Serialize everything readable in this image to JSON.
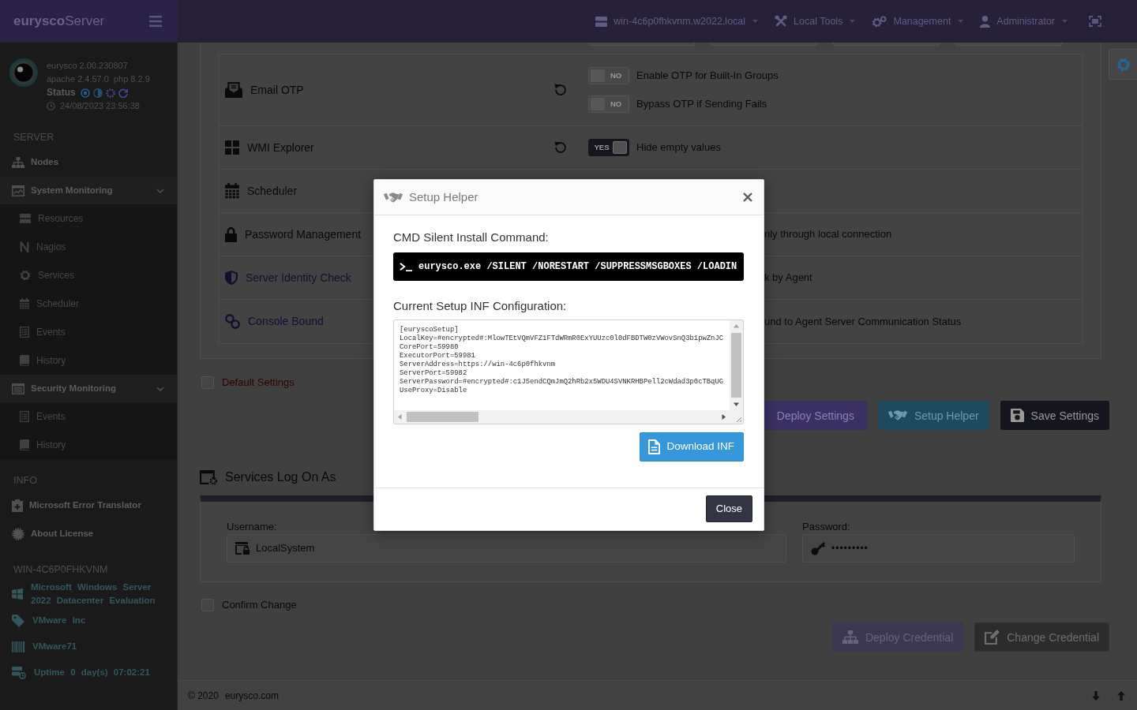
{
  "navbar": {
    "brand": "**eurysco**Server",
    "menus": [
      {
        "label": "win-4c6p0fhkvnm.w2022.local"
      },
      {
        "label": "Local Tools"
      },
      {
        "label": "Management"
      },
      {
        "label": "Administrator"
      }
    ]
  },
  "sidebar": {
    "profile": {
      "version": "eurysco 2.00.230807",
      "apache": "apache 2.4.57.0",
      "php": "php 8.2.9",
      "status_label": "Status",
      "timestamp": "24/08/2023 23:56:38"
    },
    "sections": [
      {
        "header": "SERVER",
        "kind": "menu",
        "items": [
          {
            "label": "Nodes"
          },
          {
            "label": "System Monitoring",
            "expanded": true,
            "children": [
              {
                "label": "Resources"
              },
              {
                "label": "Nagios"
              },
              {
                "label": "Services"
              },
              {
                "label": "Scheduler"
              },
              {
                "label": "Events"
              },
              {
                "label": "History"
              }
            ]
          },
          {
            "label": "Security Monitoring",
            "expanded": true,
            "children": [
              {
                "label": "Events"
              },
              {
                "label": "History"
              }
            ]
          }
        ]
      },
      {
        "header": "INFO",
        "kind": "menu",
        "items": [
          {
            "label": "Microsoft Error Translator"
          },
          {
            "label": "About License"
          }
        ]
      },
      {
        "header": "WIN-4C6P0FHKVNM",
        "kind": "host",
        "items": [
          {
            "label": "Microsoft Windows Server 2022 Datacenter Evaluation"
          },
          {
            "label": "VMware Inc"
          },
          {
            "label": "VMware71"
          },
          {
            "label": "Uptime 0 day(s) 07:02:21"
          }
        ]
      }
    ]
  },
  "settings": {
    "rows": [
      {
        "label": "Email OTP",
        "kind": "setting",
        "resettable": true,
        "options": [
          {
            "kind": "toggle",
            "toggle": "NO",
            "on": false,
            "label": "Enable OTP for Built-In Groups"
          },
          {
            "kind": "toggle",
            "toggle": "NO",
            "on": false,
            "label": "Bypass OTP if Sending Fails"
          }
        ]
      },
      {
        "label": "WMI Explorer",
        "kind": "setting",
        "resettable": true,
        "options": [
          {
            "kind": "toggle",
            "toggle": "YES",
            "on": true,
            "label": "Hide empty values"
          }
        ]
      },
      {
        "label": "Scheduler",
        "kind": "setting",
        "resettable": false
      },
      {
        "label": "Password Management",
        "kind": "setting",
        "resettable": false,
        "options": [
          {
            "kind": "text",
            "label": "nly through local connection"
          }
        ]
      },
      {
        "label": "Server Identity Check",
        "kind": "link",
        "resettable": false,
        "options": [
          {
            "kind": "text",
            "label": "k by Agent"
          }
        ]
      },
      {
        "label": "Console Bound",
        "kind": "link",
        "resettable": false,
        "options": [
          {
            "kind": "text",
            "label": "und to Agent Server Communication Status"
          }
        ]
      }
    ]
  },
  "default_settings": {
    "label": "Default Settings",
    "checked": false
  },
  "settings_buttons": [
    {
      "label": "Deploy Settings",
      "kind": "primary",
      "disabled": false
    },
    {
      "label": "Setup Helper",
      "kind": "info",
      "disabled": false
    },
    {
      "label": "Save Settings",
      "kind": "dark",
      "disabled": false
    }
  ],
  "log_on_as": {
    "title": "Services Log On As",
    "username": {
      "label": "Username:",
      "value": "LocalSystem"
    },
    "password": {
      "label": "Password:",
      "value": "•••••••••"
    },
    "confirm": {
      "label": "Confirm Change",
      "checked": false
    },
    "buttons": [
      {
        "label": "Deploy Credential",
        "kind": "primary",
        "disabled": true
      },
      {
        "label": "Change Credential",
        "kind": "secondary",
        "disabled": false
      }
    ]
  },
  "footer": {
    "copyright": "© 2020",
    "site": "eurysco.com"
  },
  "modal": {
    "title": "Setup Helper",
    "command_label": "CMD Silent Install Command:",
    "command": "eurysco.exe /SILENT /NORESTART /SUPPRESSMSGBOXES /LOADIN",
    "config_label": "Current Setup INF Configuration:",
    "config_lines": [
      "[euryscoSetup]",
      "LocalKey=#encrypted#:MlowTEtVQmVFZ1FTdWRmR0ExYUUzc0l0dFBDTW0zVWovSnQ3b1pwZnJC",
      "CorePort=59980",
      "ExecutorPort=59981",
      "ServerAddress=https://win-4c6p0fhkvnm",
      "ServerPort=59982",
      "ServerPassword=#encrypted#:c1J5endCQmJmQ2hRb2x5WDU4SVNKRHBPell2cWdad3p0cTBqUG",
      "UseProxy=Disable"
    ],
    "download_button": "Download INF",
    "close_button": "Close"
  }
}
